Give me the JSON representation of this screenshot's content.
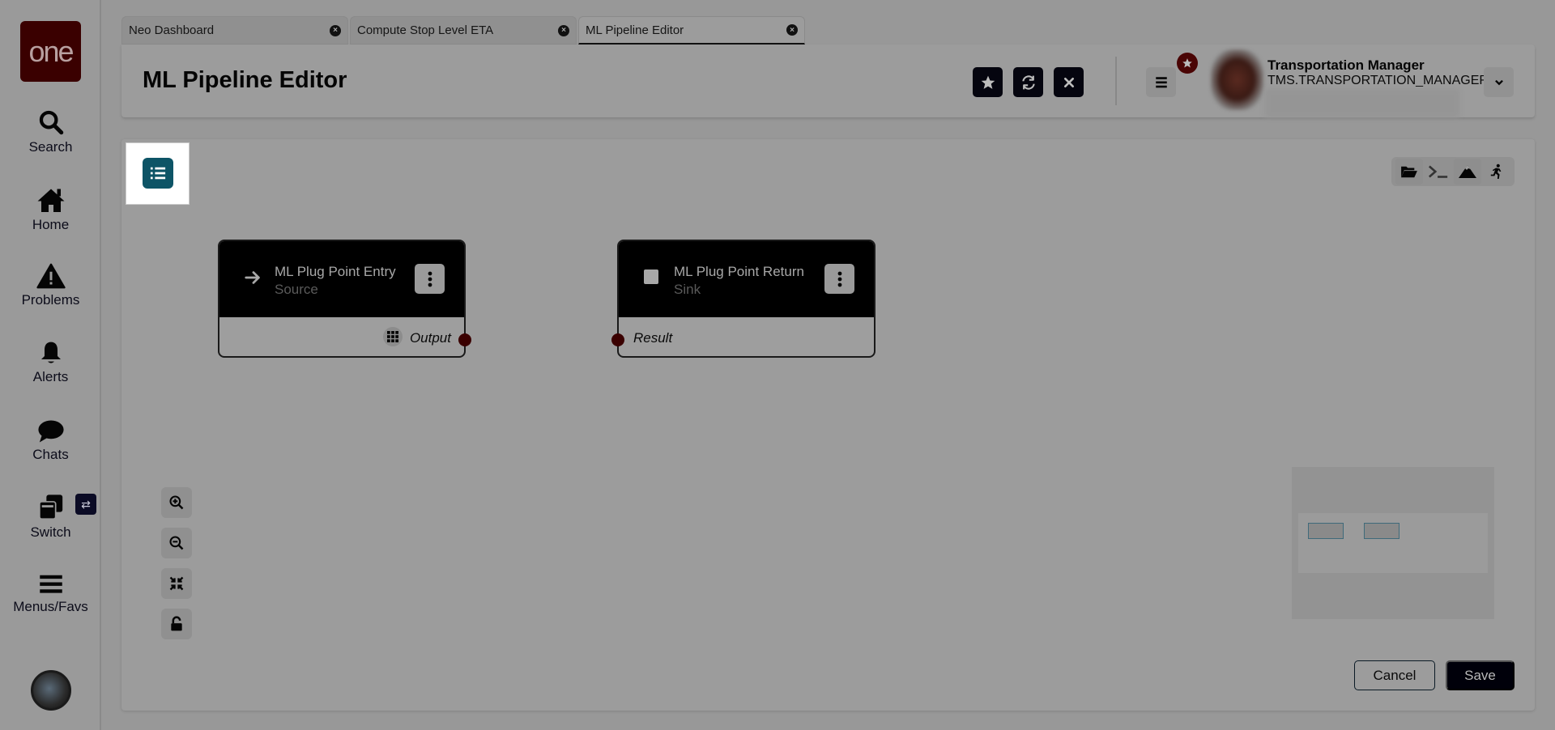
{
  "sidebar": {
    "logo_text": "one",
    "items": [
      {
        "label": "Search",
        "icon": "search-icon"
      },
      {
        "label": "Home",
        "icon": "home-icon"
      },
      {
        "label": "Problems",
        "icon": "warning-icon"
      },
      {
        "label": "Alerts",
        "icon": "bell-icon"
      },
      {
        "label": "Chats",
        "icon": "chat-icon"
      },
      {
        "label": "Switch",
        "icon": "switch-icon"
      },
      {
        "label": "Menus/Favs",
        "icon": "hamburger-icon"
      }
    ],
    "switch_badge": "⇄"
  },
  "tabs": [
    {
      "label": "Neo Dashboard",
      "active": false
    },
    {
      "label": "Compute Stop Level ETA",
      "active": false
    },
    {
      "label": "ML Pipeline Editor",
      "active": true
    }
  ],
  "header": {
    "title": "ML Pipeline Editor",
    "actions": [
      "favorite",
      "refresh",
      "close"
    ],
    "user": {
      "name": "Transportation Manager",
      "role": "TMS.TRANSPORTATION_MANAGER"
    }
  },
  "canvas": {
    "toolbar": [
      "open-folder",
      "console",
      "mountain",
      "run"
    ],
    "nodes": [
      {
        "title": "ML Plug Point Entry",
        "subtitle": "Source",
        "port_label": "Output",
        "port_side": "right"
      },
      {
        "title": "ML Plug Point Return",
        "subtitle": "Sink",
        "port_label": "Result",
        "port_side": "left"
      }
    ],
    "zoom_controls": [
      "zoom-in",
      "zoom-out",
      "fit-view",
      "unlock"
    ]
  },
  "footer": {
    "cancel_label": "Cancel",
    "save_label": "Save"
  },
  "colors": {
    "accent_teal": "#0d5466",
    "logo_bg": "#3a0000",
    "port": "#3a0000"
  }
}
